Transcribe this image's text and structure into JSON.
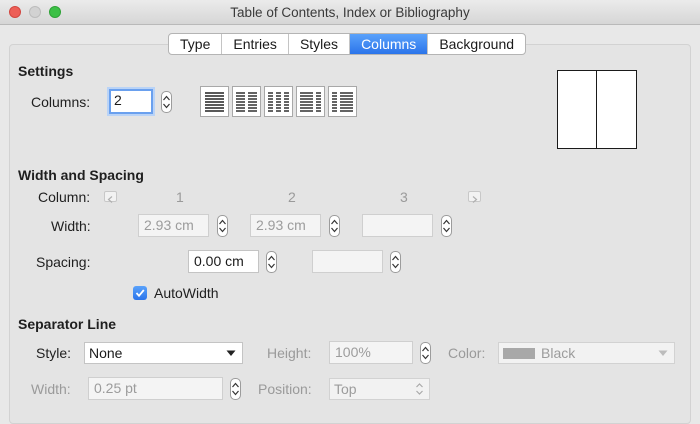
{
  "window": {
    "title": "Table of Contents, Index or Bibliography"
  },
  "tabs": [
    {
      "label": "Type",
      "active": false
    },
    {
      "label": "Entries",
      "active": false
    },
    {
      "label": "Styles",
      "active": false
    },
    {
      "label": "Columns",
      "active": true
    },
    {
      "label": "Background",
      "active": false
    }
  ],
  "settings": {
    "heading": "Settings",
    "columns_label": "Columns:",
    "columns_value": "2",
    "presets": [
      "one-column-preset-icon",
      "two-columns-preset-icon",
      "three-columns-preset-icon",
      "two-columns-left-wide-preset-icon",
      "two-columns-right-wide-preset-icon"
    ]
  },
  "width_spacing": {
    "heading": "Width and Spacing",
    "column_label": "Column:",
    "column_numbers": [
      "1",
      "2",
      "3"
    ],
    "width_label": "Width:",
    "widths": [
      "2.93 cm",
      "2.93 cm",
      ""
    ],
    "spacing_label": "Spacing:",
    "spacings": [
      "0.00 cm",
      ""
    ],
    "autowidth_label": "AutoWidth",
    "autowidth_checked": true
  },
  "separator": {
    "heading": "Separator Line",
    "style_label": "Style:",
    "style_value": "None",
    "height_label": "Height:",
    "height_value": "100%",
    "color_label": "Color:",
    "color_value": "Black",
    "color_swatch": "#a8a8a8",
    "width_label": "Width:",
    "width_value": "0.25 pt",
    "position_label": "Position:",
    "position_value": "Top"
  },
  "colors": {
    "accent": "#2b74ea",
    "close": "#ed5f57",
    "maximize": "#3cc046"
  }
}
